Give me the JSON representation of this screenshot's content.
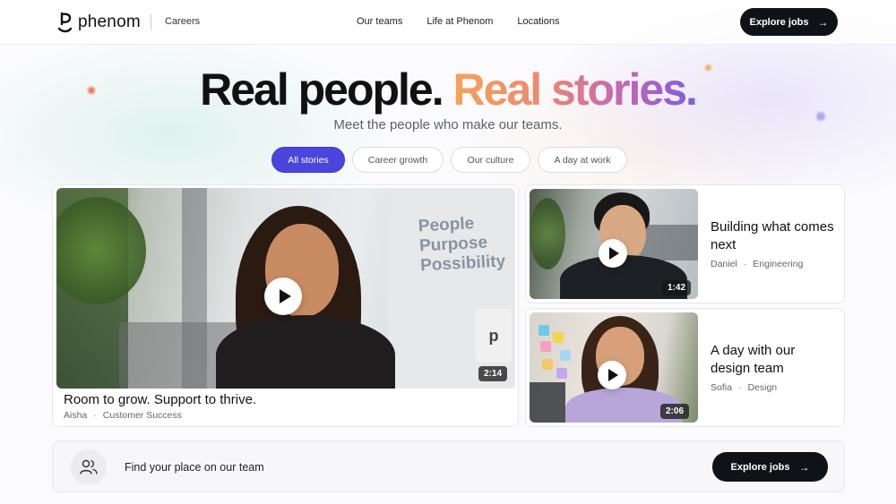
{
  "header": {
    "logo_text": "phenom",
    "section": "Careers",
    "nav": [
      "Our teams",
      "Life at Phenom",
      "Locations"
    ],
    "cta_label": "Explore jobs",
    "cta_icon": "arrow-right-icon"
  },
  "hero": {
    "title_plain": "Real people.",
    "title_accent": "Real stories.",
    "subtitle": "Meet the people who make our teams.",
    "accent_gradient": [
      "#f6a25b",
      "#ee8a6f",
      "#c267b4",
      "#7b5ce0"
    ]
  },
  "filters": {
    "items": [
      "All stories",
      "Career growth",
      "Our culture",
      "A day at work"
    ],
    "selected": "All stories",
    "active_color": "#4a45dd"
  },
  "featured": {
    "wall_text": [
      "People",
      "Purpose",
      "Possibility"
    ],
    "duration": "2:14",
    "title": "Room to grow. Support to thrive.",
    "name": "Aisha",
    "team": "Customer Success"
  },
  "stories": [
    {
      "title": "Building what comes next",
      "name": "Daniel",
      "team": "Engineering",
      "duration": "1:42"
    },
    {
      "title": "A day with our design team",
      "name": "Sofia",
      "team": "Design",
      "duration": "2:06"
    }
  ],
  "meta_separator": "·",
  "bottom": {
    "icon": "people-icon",
    "text": "Find your place on our team",
    "cta_label": "Explore jobs",
    "cta_icon": "arrow-right-icon"
  }
}
